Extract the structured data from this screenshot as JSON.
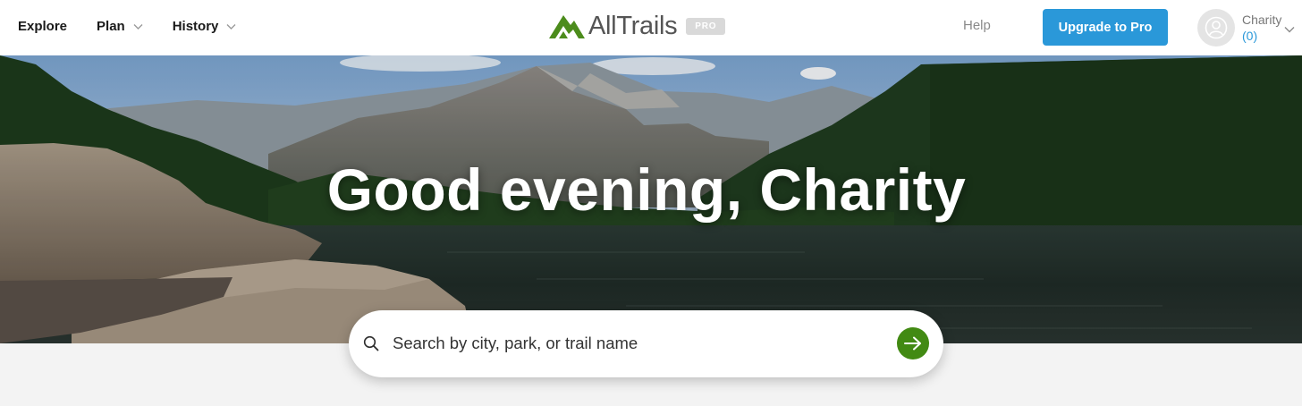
{
  "nav": {
    "items": [
      {
        "label": "Explore",
        "has_menu": false
      },
      {
        "label": "Plan",
        "has_menu": true
      },
      {
        "label": "History",
        "has_menu": true
      }
    ],
    "logo": {
      "wordmark": "AllTrails",
      "badge": "PRO"
    },
    "help_label": "Help",
    "upgrade_label": "Upgrade to Pro",
    "account": {
      "name": "Charity",
      "count": "(0)"
    }
  },
  "hero": {
    "greeting": "Good evening, Charity"
  },
  "search": {
    "placeholder": "Search by city, park, or trail name"
  },
  "colors": {
    "brand_green": "#428a13",
    "upgrade_blue": "#2a98d9",
    "page_background": "#f3f3f3"
  },
  "icons": [
    "chevron-down-icon",
    "alltrails-logo-mark",
    "user-avatar-icon",
    "search-icon",
    "arrow-right-icon"
  ]
}
